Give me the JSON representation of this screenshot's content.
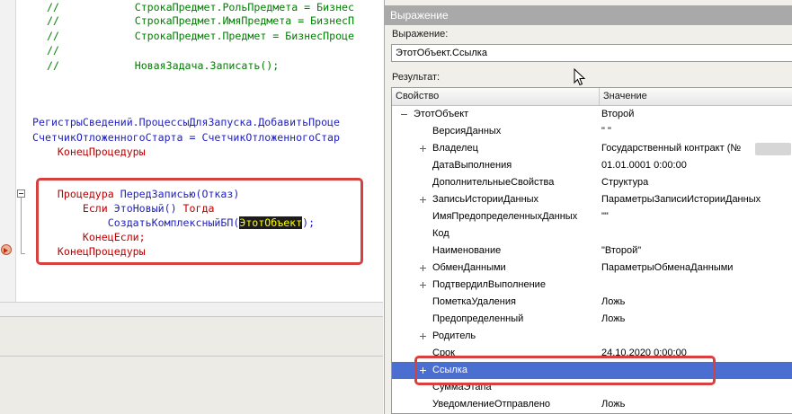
{
  "editor": {
    "lines": [
      {
        "segments": [
          {
            "cls": "c-com",
            "text": "//            СтрокаПредмет.РольПредмета = Бизнес"
          }
        ]
      },
      {
        "segments": [
          {
            "cls": "c-com",
            "text": "//            СтрокаПредмет.ИмяПредмета = БизнесП"
          }
        ]
      },
      {
        "segments": [
          {
            "cls": "c-com",
            "text": "//            СтрокаПредмет.Предмет = БизнесПроце"
          }
        ]
      },
      {
        "segments": [
          {
            "cls": "c-com",
            "text": "//"
          }
        ]
      },
      {
        "segments": [
          {
            "cls": "c-com",
            "text": "//            НоваяЗадача.Записать();"
          }
        ]
      },
      {
        "segments": [
          {
            "cls": "c-id",
            "text": "РегистрыСведений.ПроцессыДляЗапуска.ДобавитьПроце"
          }
        ]
      },
      {
        "segments": [
          {
            "cls": "c-id",
            "text": "СчетчикОтложенногоСтарта = СчетчикОтложенногоСтар"
          }
        ]
      },
      {
        "segments": [
          {
            "cls": "c-kw",
            "text": "    КонецПроцедуры"
          }
        ]
      },
      {
        "segments": [
          {
            "cls": "c-kw",
            "text": "    Процедура "
          },
          {
            "cls": "c-id",
            "text": "ПередЗаписью(Отказ)"
          }
        ]
      },
      {
        "segments": [
          {
            "cls": "c-kw",
            "text": "        Если "
          },
          {
            "cls": "c-id",
            "text": "ЭтоНовый() "
          },
          {
            "cls": "c-kw",
            "text": "Тогда"
          }
        ]
      },
      {
        "segments": [
          {
            "cls": "c-id",
            "text": "            СоздатьКомплексныйБП("
          },
          {
            "cls": "c-hl",
            "text": "ЭтотОбъект"
          },
          {
            "cls": "c-id",
            "text": ");"
          }
        ]
      },
      {
        "segments": [
          {
            "cls": "c-kw",
            "text": "        КонецЕсли;"
          }
        ]
      },
      {
        "segments": [
          {
            "cls": "c-kw",
            "text": "    КонецПроцедуры"
          }
        ]
      }
    ]
  },
  "expression_panel": {
    "title": "Выражение",
    "expression_label": "Выражение:",
    "expression_value": "ЭтотОбъект.Ссылка",
    "result_label": "Результат:",
    "columns": {
      "property": "Свойство",
      "value": "Значение"
    },
    "rows": [
      {
        "name": "ЭтотОбъект",
        "value": "Второй",
        "expander": "minus",
        "root": true
      },
      {
        "name": "ВерсияДанных",
        "value": "\"           \"",
        "expander": "none"
      },
      {
        "name": "Владелец",
        "value": "Государственный контракт (№",
        "expander": "plus",
        "redacted": true
      },
      {
        "name": "ДатаВыполнения",
        "value": "01.01.0001 0:00:00",
        "expander": "none"
      },
      {
        "name": "ДополнительныеСвойства",
        "value": "Структура",
        "expander": "none"
      },
      {
        "name": "ЗаписьИсторииДанных",
        "value": "ПараметрыЗаписиИсторииДанных",
        "expander": "plus"
      },
      {
        "name": "ИмяПредопределенныхДанных",
        "value": "\"\"",
        "expander": "none"
      },
      {
        "name": "Код",
        "value": "",
        "expander": "none"
      },
      {
        "name": "Наименование",
        "value": "\"Второй\"",
        "expander": "none"
      },
      {
        "name": "ОбменДанными",
        "value": "ПараметрыОбменаДанными",
        "expander": "plus"
      },
      {
        "name": "ПодтвердилВыполнение",
        "value": "",
        "expander": "plus"
      },
      {
        "name": "ПометкаУдаления",
        "value": "Ложь",
        "expander": "none"
      },
      {
        "name": "Предопределенный",
        "value": "Ложь",
        "expander": "none"
      },
      {
        "name": "Родитель",
        "value": "",
        "expander": "plus"
      },
      {
        "name": "Срок",
        "value": "24.10.2020 0:00:00",
        "expander": "none"
      },
      {
        "name": "Ссылка",
        "value": "",
        "expander": "plus",
        "selected": true
      },
      {
        "name": "СуммаЭтапа",
        "value": "",
        "expander": "none"
      },
      {
        "name": "УведомлениеОтправлено",
        "value": "Ложь",
        "expander": "none"
      }
    ]
  },
  "colors": {
    "selection": "#4b6fd1",
    "annotation_box": "#d84040",
    "keyword": "#c00000",
    "identifier": "#1f1fbf",
    "comment": "#008000"
  }
}
